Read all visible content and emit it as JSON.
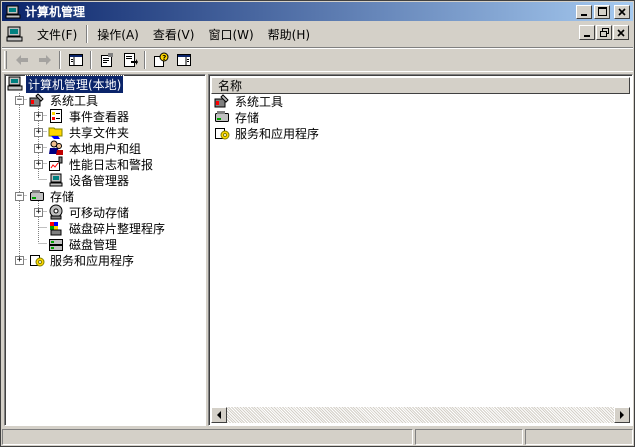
{
  "window": {
    "title": "计算机管理"
  },
  "menu": {
    "items": [
      {
        "label": "文件(F)"
      },
      {
        "label": "操作(A)"
      },
      {
        "label": "查看(V)"
      },
      {
        "label": "窗口(W)"
      },
      {
        "label": "帮助(H)"
      }
    ]
  },
  "toolbar": {
    "buttons": [
      "back-arrow-icon",
      "forward-arrow-icon",
      "show-hide-tree-icon",
      "properties-icon",
      "export-list-icon",
      "help-icon",
      "show-hide-action-pane-icon"
    ]
  },
  "tree": {
    "root": "计算机管理(本地)",
    "nodes": [
      {
        "label": "系统工具"
      },
      {
        "label": "事件查看器"
      },
      {
        "label": "共享文件夹"
      },
      {
        "label": "本地用户和组"
      },
      {
        "label": "性能日志和警报"
      },
      {
        "label": "设备管理器"
      },
      {
        "label": "存储"
      },
      {
        "label": "可移动存储"
      },
      {
        "label": "磁盘碎片整理程序"
      },
      {
        "label": "磁盘管理"
      },
      {
        "label": "服务和应用程序"
      }
    ]
  },
  "list": {
    "column_name": "名称",
    "items": [
      {
        "label": "系统工具"
      },
      {
        "label": "存储"
      },
      {
        "label": "服务和应用程序"
      }
    ]
  },
  "colors": {
    "title_start": "#0a246a",
    "title_end": "#a6caf0",
    "selection": "#0a246a",
    "chrome": "#d4d0c8"
  }
}
